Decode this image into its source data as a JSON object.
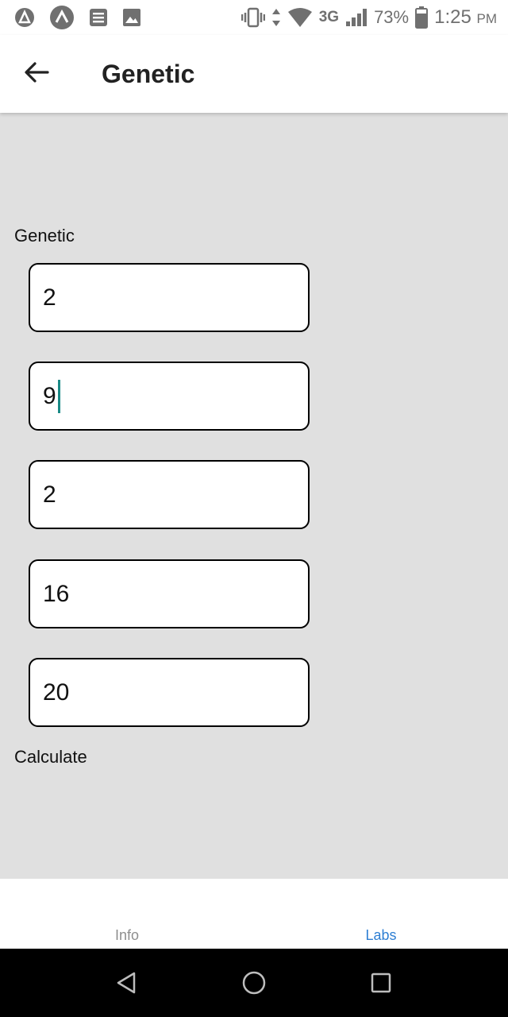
{
  "status_bar": {
    "battery_percent": "73%",
    "network": "3G",
    "time": "1:25",
    "meridiem": "PM",
    "icons": [
      "app-notification-icon",
      "app-notification-icon",
      "document-icon",
      "image-icon",
      "vibrate-icon",
      "data-arrows-icon",
      "wifi-icon",
      "signal-icon",
      "battery-icon"
    ]
  },
  "app_bar": {
    "title": "Genetic",
    "back_icon": "arrow-left-icon"
  },
  "main": {
    "section_label": "Genetic",
    "fields": [
      {
        "value": "2"
      },
      {
        "value": "9",
        "focused": true
      },
      {
        "value": "2"
      },
      {
        "value": "16"
      },
      {
        "value": "20"
      }
    ],
    "calculate_label": "Calculate"
  },
  "tabs": [
    {
      "label": "Info",
      "active": false
    },
    {
      "label": "Labs",
      "active": true
    }
  ],
  "colors": {
    "background": "#e0e0e0",
    "active_tab": "#2f7fd3",
    "inactive_tab": "#8e8e8e",
    "caret": "#1a8a86"
  },
  "nav_bar": {
    "icons": [
      "back-triangle-icon",
      "home-circle-icon",
      "recents-square-icon"
    ]
  }
}
